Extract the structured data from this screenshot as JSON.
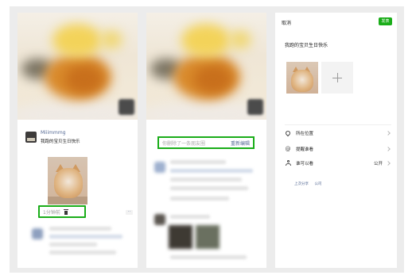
{
  "panel1": {
    "post": {
      "username": "Miiimmmg",
      "text": "我跑的宝贝生日快乐",
      "time": "1分钟前"
    },
    "more_label": "··"
  },
  "panel2": {
    "toast": {
      "message": "你删除了一条朋友圈",
      "action": "重新编辑"
    }
  },
  "panel3": {
    "nav": {
      "cancel": "取消",
      "publish": "发表"
    },
    "compose_text": "我跑的宝贝生日快乐",
    "options": [
      {
        "label": "所在位置",
        "value": ""
      },
      {
        "label": "提醒谁看",
        "value": ""
      },
      {
        "label": "谁可以看",
        "value": "公开"
      }
    ],
    "sync": [
      "上次分享",
      "公司"
    ]
  },
  "icons": {
    "trash": "trash-icon",
    "location": "location-icon",
    "mention": "at-icon",
    "visibility": "person-icon",
    "add": "plus-icon",
    "chevron": "chevron-right-icon"
  },
  "colors": {
    "accent": "#1aad19",
    "link": "#576b95"
  }
}
